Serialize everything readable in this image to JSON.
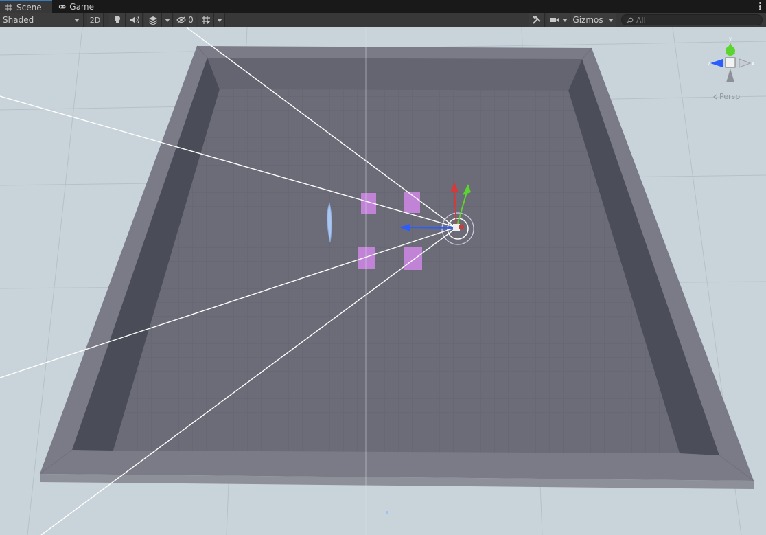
{
  "tabs": [
    {
      "label": "Scene",
      "icon": "grid-icon",
      "active": true
    },
    {
      "label": "Game",
      "icon": "gamepad-icon",
      "active": false
    }
  ],
  "toolbar": {
    "draw_mode": "Shaded",
    "mode_2d": "2D",
    "hidden_count": "0",
    "gizmos_label": "Gizmos",
    "search_placeholder": "All"
  },
  "viewport": {
    "projection_label": "Persp",
    "axis_colors": {
      "x": "#d43a3a",
      "y": "#5cd62c",
      "z": "#2a5cff"
    }
  }
}
